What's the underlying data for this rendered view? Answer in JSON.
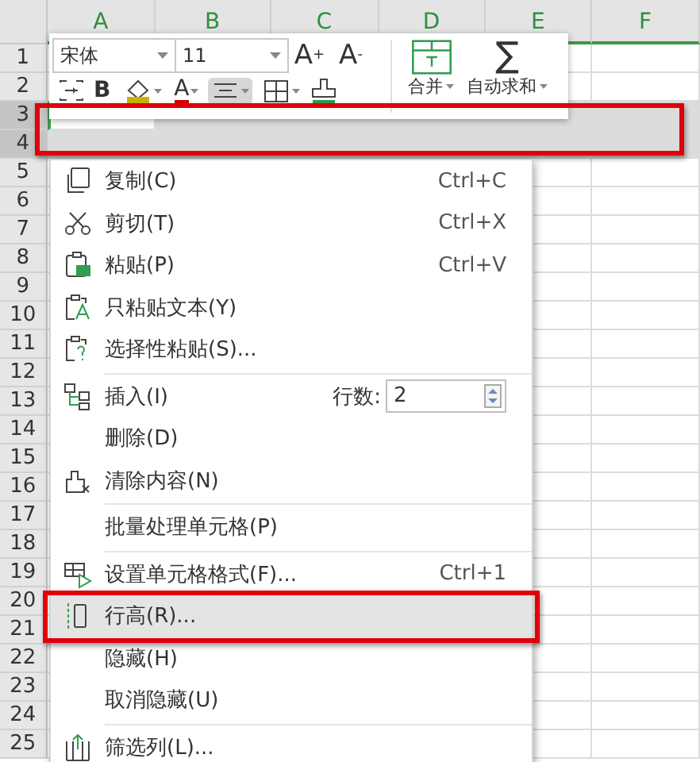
{
  "columns": [
    "A",
    "B",
    "C",
    "D",
    "E",
    "F"
  ],
  "rows": [
    {
      "label": "1",
      "selected": false
    },
    {
      "label": "2",
      "selected": false
    },
    {
      "label": "3",
      "selected": true
    },
    {
      "label": "4",
      "selected": true
    },
    {
      "label": "5",
      "selected": false
    },
    {
      "label": "6",
      "selected": false
    },
    {
      "label": "7",
      "selected": false
    },
    {
      "label": "8",
      "selected": false
    },
    {
      "label": "9",
      "selected": false
    },
    {
      "label": "10",
      "selected": false
    },
    {
      "label": "11",
      "selected": false
    },
    {
      "label": "12",
      "selected": false
    },
    {
      "label": "13",
      "selected": false
    },
    {
      "label": "14",
      "selected": false
    },
    {
      "label": "15",
      "selected": false
    },
    {
      "label": "16",
      "selected": false
    },
    {
      "label": "17",
      "selected": false
    },
    {
      "label": "18",
      "selected": false
    },
    {
      "label": "19",
      "selected": false
    },
    {
      "label": "20",
      "selected": false
    },
    {
      "label": "21",
      "selected": false
    },
    {
      "label": "22",
      "selected": false
    },
    {
      "label": "23",
      "selected": false
    },
    {
      "label": "24",
      "selected": false
    },
    {
      "label": "25",
      "selected": false
    }
  ],
  "selection_framed": true,
  "toolbar": {
    "font": "宋体",
    "size": "11",
    "grow": "A$^{+}$",
    "shrink": "A$^{-}$",
    "bold": "B",
    "font_color": "A",
    "align_pressed": true,
    "merge": "合并",
    "sum_symbol": "∑",
    "autosum": "自动求和"
  },
  "menu": [
    {
      "kind": "item",
      "label": "复制(C)",
      "shortcut": "Ctrl+C",
      "selected": false
    },
    {
      "kind": "item",
      "label": "剪切(T)",
      "shortcut": "Ctrl+X",
      "selected": false
    },
    {
      "kind": "item",
      "label": "粘贴(P)",
      "shortcut": "Ctrl+V",
      "selected": false
    },
    {
      "kind": "item",
      "label": "只粘贴文本(Y)",
      "selected": false
    },
    {
      "kind": "item",
      "label": "选择性粘贴(S)...",
      "selected": false
    },
    {
      "kind": "separator"
    },
    {
      "kind": "spin",
      "label": "插入(I)",
      "spin_label": "行数:",
      "value": "2",
      "selected": false
    },
    {
      "kind": "item",
      "label": "删除(D)",
      "selected": false
    },
    {
      "kind": "item",
      "label": "清除内容(N)",
      "selected": false
    },
    {
      "kind": "separator"
    },
    {
      "kind": "item",
      "label": "批量处理单元格(P)",
      "selected": false
    },
    {
      "kind": "separator"
    },
    {
      "kind": "item",
      "label": "设置单元格格式(F)...",
      "shortcut": "Ctrl+1",
      "selected": false
    },
    {
      "kind": "item",
      "label": "行高(R)...",
      "selected": true,
      "framed": true
    },
    {
      "kind": "item",
      "label": "隐藏(H)",
      "selected": false
    },
    {
      "kind": "item",
      "label": "取消隐藏(U)",
      "selected": false
    },
    {
      "kind": "separator"
    },
    {
      "kind": "item",
      "label": "筛选列(L)...",
      "selected": false
    }
  ]
}
